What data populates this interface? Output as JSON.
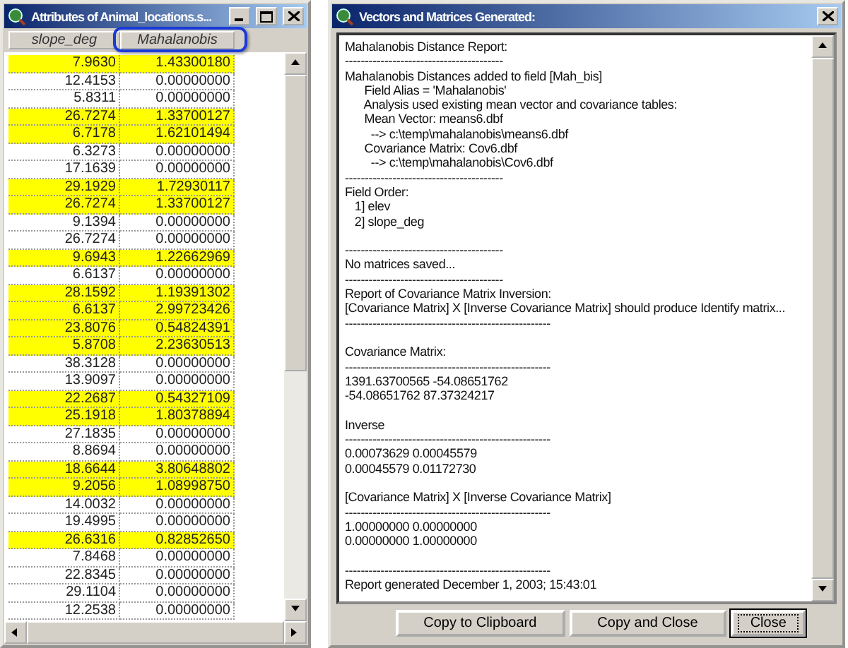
{
  "attributes_window": {
    "title": "Attributes of Animal_locations.s...",
    "columns": [
      "slope_deg",
      "Mahalanobis"
    ],
    "rows": [
      {
        "cells": [
          "7.9630",
          "1.43300180"
        ],
        "selected": true
      },
      {
        "cells": [
          "12.4153",
          "0.00000000"
        ],
        "selected": false
      },
      {
        "cells": [
          "5.8311",
          "0.00000000"
        ],
        "selected": false
      },
      {
        "cells": [
          "26.7274",
          "1.33700127"
        ],
        "selected": true
      },
      {
        "cells": [
          "6.7178",
          "1.62101494"
        ],
        "selected": true
      },
      {
        "cells": [
          "6.3273",
          "0.00000000"
        ],
        "selected": false
      },
      {
        "cells": [
          "17.1639",
          "0.00000000"
        ],
        "selected": false
      },
      {
        "cells": [
          "29.1929",
          "1.72930117"
        ],
        "selected": true
      },
      {
        "cells": [
          "26.7274",
          "1.33700127"
        ],
        "selected": true
      },
      {
        "cells": [
          "9.1394",
          "0.00000000"
        ],
        "selected": false
      },
      {
        "cells": [
          "26.7274",
          "0.00000000"
        ],
        "selected": false
      },
      {
        "cells": [
          "9.6943",
          "1.22662969"
        ],
        "selected": true
      },
      {
        "cells": [
          "6.6137",
          "0.00000000"
        ],
        "selected": false
      },
      {
        "cells": [
          "28.1592",
          "1.19391302"
        ],
        "selected": true
      },
      {
        "cells": [
          "6.6137",
          "2.99723426"
        ],
        "selected": true
      },
      {
        "cells": [
          "23.8076",
          "0.54824391"
        ],
        "selected": true
      },
      {
        "cells": [
          "5.8708",
          "2.23630513"
        ],
        "selected": true
      },
      {
        "cells": [
          "38.3128",
          "0.00000000"
        ],
        "selected": false
      },
      {
        "cells": [
          "13.9097",
          "0.00000000"
        ],
        "selected": false
      },
      {
        "cells": [
          "22.2687",
          "0.54327109"
        ],
        "selected": true
      },
      {
        "cells": [
          "25.1918",
          "1.80378894"
        ],
        "selected": true
      },
      {
        "cells": [
          "27.1835",
          "0.00000000"
        ],
        "selected": false
      },
      {
        "cells": [
          "8.8694",
          "0.00000000"
        ],
        "selected": false
      },
      {
        "cells": [
          "18.6644",
          "3.80648802"
        ],
        "selected": true
      },
      {
        "cells": [
          "9.2056",
          "1.08998750"
        ],
        "selected": true
      },
      {
        "cells": [
          "14.0032",
          "0.00000000"
        ],
        "selected": false
      },
      {
        "cells": [
          "19.4995",
          "0.00000000"
        ],
        "selected": false
      },
      {
        "cells": [
          "26.6316",
          "0.82852650"
        ],
        "selected": true
      },
      {
        "cells": [
          "7.8468",
          "0.00000000"
        ],
        "selected": false
      },
      {
        "cells": [
          "22.8345",
          "0.00000000"
        ],
        "selected": false
      },
      {
        "cells": [
          "29.1104",
          "0.00000000"
        ],
        "selected": false
      },
      {
        "cells": [
          "12.2538",
          "0.00000000"
        ],
        "selected": false
      }
    ]
  },
  "report_window": {
    "title": "Vectors and Matrices Generated:",
    "sections": [
      {
        "lines": [
          "Mahalanobis Distance Report:",
          "----------------------------------------",
          "Mahalanobis Distances added to field [Mah_bis]",
          "      Field Alias = 'Mahalanobis'",
          "      Analysis used existing mean vector and covariance tables:",
          "      Mean Vector: means6.dbf",
          "        --> c:\\temp\\mahalanobis\\means6.dbf",
          "      Covariance Matrix: Cov6.dbf",
          "        --> c:\\temp\\mahalanobis\\Cov6.dbf",
          "----------------------------------------",
          "Field Order:",
          "   1] elev",
          "   2] slope_deg"
        ]
      },
      {
        "lines": [
          "----------------------------------------",
          "No matrices saved...",
          "----------------------------------------",
          "Report of Covariance Matrix Inversion:",
          "[Covariance Matrix] X [Inverse Covariance Matrix] should produce Identify matrix...",
          "----------------------------------------------------"
        ]
      },
      {
        "lines": [
          "Covariance Matrix:",
          "----------------------------------------------------",
          "1391.63700565 -54.08651762",
          "-54.08651762 87.37324217"
        ]
      },
      {
        "lines": [
          "Inverse",
          "----------------------------------------------------",
          "0.00073629 0.00045579",
          "0.00045579 0.01172730"
        ]
      },
      {
        "lines": [
          "[Covariance Matrix] X [Inverse Covariance Matrix]",
          "----------------------------------------------------",
          "1.00000000 0.00000000",
          "0.00000000 1.00000000"
        ]
      },
      {
        "lines": [
          "----------------------------------------------------",
          "Report generated December 1, 2003; 15:43:01"
        ]
      }
    ],
    "buttons": [
      {
        "label": "Copy to Clipboard",
        "focused": false
      },
      {
        "label": "Copy and Close",
        "focused": false
      },
      {
        "label": "Close",
        "focused": true
      }
    ]
  }
}
